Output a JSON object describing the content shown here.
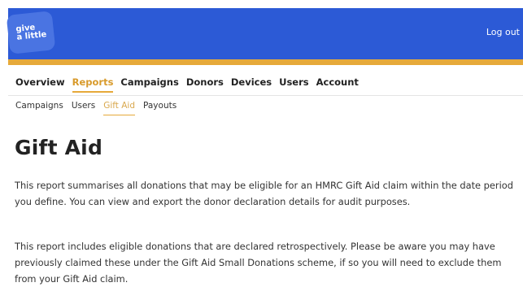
{
  "header": {
    "logo_line1": "give",
    "logo_line2": "a little",
    "logout_label": "Log out"
  },
  "main_nav": [
    {
      "label": "Overview",
      "active": false
    },
    {
      "label": "Reports",
      "active": true
    },
    {
      "label": "Campaigns",
      "active": false
    },
    {
      "label": "Donors",
      "active": false
    },
    {
      "label": "Devices",
      "active": false
    },
    {
      "label": "Users",
      "active": false
    },
    {
      "label": "Account",
      "active": false
    }
  ],
  "sub_nav": [
    {
      "label": "Campaigns",
      "active": false
    },
    {
      "label": "Users",
      "active": false
    },
    {
      "label": "Gift Aid",
      "active": true
    },
    {
      "label": "Payouts",
      "active": false
    }
  ],
  "page": {
    "title": "Gift Aid",
    "paragraph1": "This report summarises all donations that may be eligible for an HMRC Gift Aid claim within the date period you define. You can view and export the donor declaration details for audit purposes.",
    "paragraph2": "This report includes eligible donations that are declared retrospectively. Please be aware you may have previously claimed these under the Gift Aid Small Donations scheme, if so you will need to exclude them from your Gift Aid claim."
  },
  "colors": {
    "brand_blue": "#2c5ad6",
    "accent_gold": "#e6a93a"
  }
}
